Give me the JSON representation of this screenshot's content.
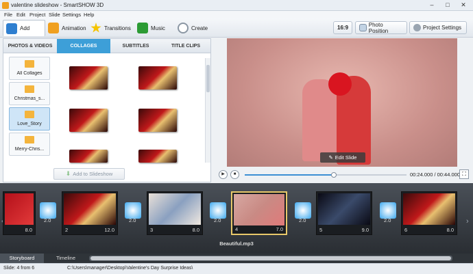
{
  "window": {
    "title": "valentine slideshow - SmartSHOW 3D",
    "controls": [
      "–",
      "□",
      "✕"
    ]
  },
  "menu": [
    "File",
    "Edit",
    "Project",
    "Slide",
    "Settings",
    "Help"
  ],
  "toolbar": {
    "tabs": [
      {
        "label": "Add",
        "icon": "add-media-icon",
        "color": "#2f7fd0"
      },
      {
        "label": "Animation",
        "icon": "animation-icon",
        "color": "#f0a020"
      },
      {
        "label": "Transitions",
        "icon": "transitions-star-icon",
        "color": "#f5c400"
      },
      {
        "label": "Music",
        "icon": "music-note-icon",
        "color": "#2c9b34"
      },
      {
        "label": "Create",
        "icon": "create-disc-icon",
        "color": "#8a96a3"
      }
    ],
    "aspect": "16:9",
    "photo_position": "Photo Position",
    "project_settings": "Project Settings"
  },
  "subtabs": [
    "PHOTOS & VIDEOS",
    "COLLAGES",
    "SUBTITLES",
    "TITLE CLIPS"
  ],
  "categories": [
    "All Collages",
    "Christmas_s...",
    "Love_Story",
    "Merry-Chris..."
  ],
  "add_button": "Add to Slideshow",
  "preview": {
    "edit_slide": "Edit Slide"
  },
  "player": {
    "time": "00:24.000 / 00:44.000",
    "progress": 0.55
  },
  "storyboard": {
    "slides": [
      {
        "num": "",
        "dur": "8.0"
      },
      {
        "num": "2",
        "dur": "12.0"
      },
      {
        "num": "3",
        "dur": "8.0"
      },
      {
        "num": "4",
        "dur": "7.0"
      },
      {
        "num": "5",
        "dur": "9.0"
      },
      {
        "num": "6",
        "dur": "8.0"
      }
    ],
    "transitions": [
      "2.0",
      "2.0",
      "2.0",
      "2.0",
      "2.0",
      "2.0"
    ],
    "music": "Beautiful.mp3"
  },
  "bottom_tabs": [
    "Storyboard",
    "Timeline"
  ],
  "status": {
    "slide": "Slide: 4 from 6",
    "path": "C:\\Users\\manager\\Desktop\\Valentine's Day Surprise Ideas\\"
  },
  "accent": "#3d9fd8"
}
